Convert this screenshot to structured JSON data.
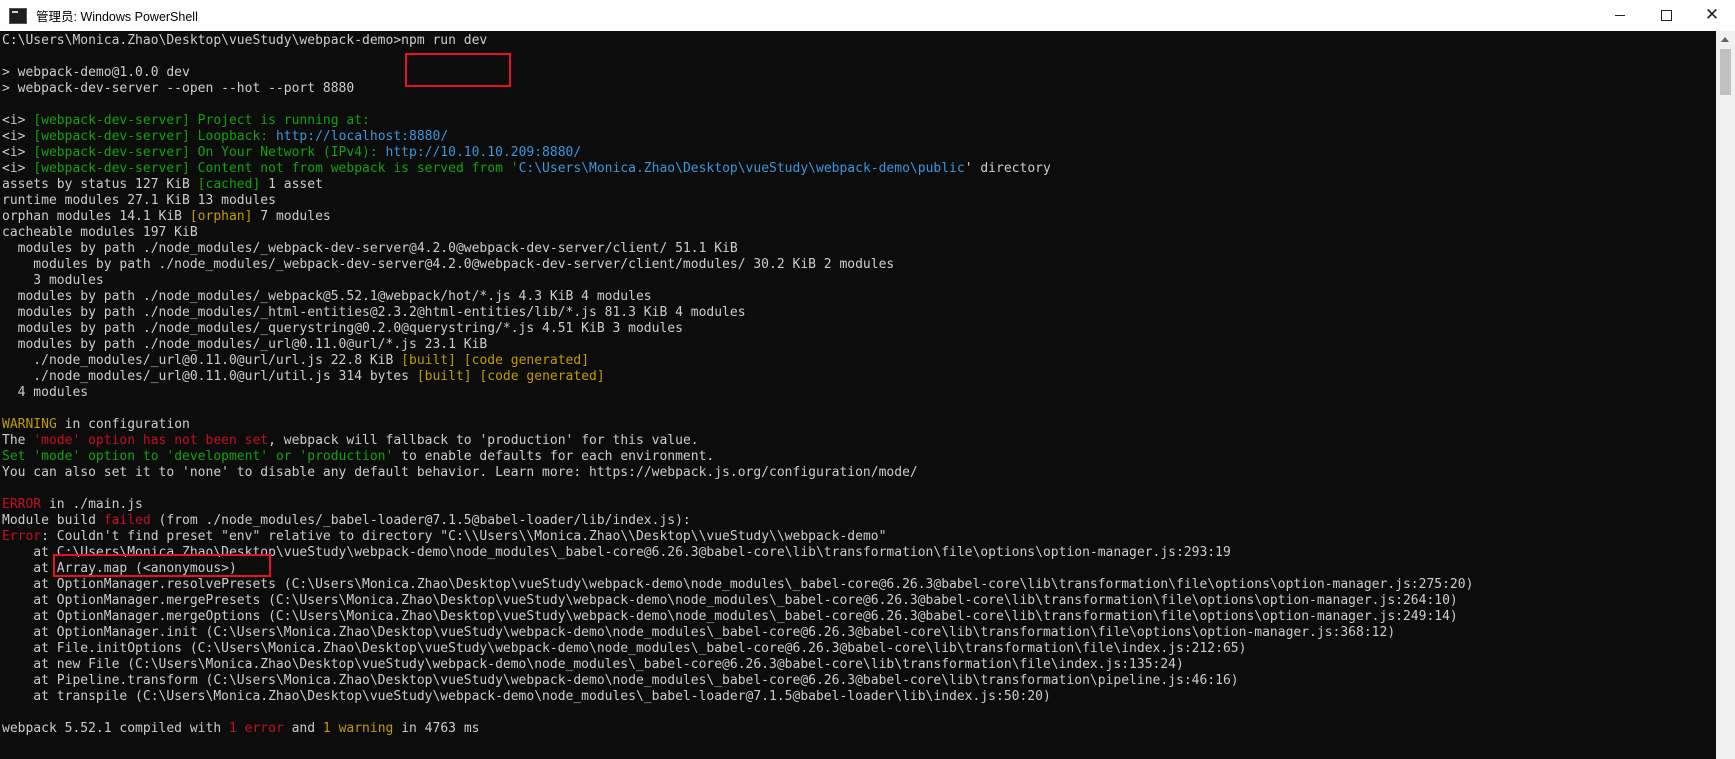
{
  "window": {
    "title": "管理员: Windows PowerShell",
    "icon": "powershell-console-icon",
    "buttons": [
      "minimize-icon",
      "maximize-icon",
      "close-icon"
    ]
  },
  "highlight_color": "#e81123",
  "console": {
    "lines": [
      [
        {
          "t": "C:\\Users\\Monica.Zhao\\Desktop\\vueStudy\\webpack-demo>npm run dev",
          "c": "c-default"
        }
      ],
      [
        {
          "t": "",
          "c": "c-default"
        }
      ],
      [
        {
          "t": "> webpack-demo@1.0.0 dev",
          "c": "c-default"
        }
      ],
      [
        {
          "t": "> webpack-dev-server --open --hot --port 8880",
          "c": "c-default"
        }
      ],
      [
        {
          "t": "",
          "c": "c-default"
        }
      ],
      [
        {
          "t": "<i> ",
          "c": "c-default"
        },
        {
          "t": "[webpack-dev-server] Project is running at:",
          "c": "c-green"
        }
      ],
      [
        {
          "t": "<i> ",
          "c": "c-default"
        },
        {
          "t": "[webpack-dev-server] Loopback: ",
          "c": "c-green"
        },
        {
          "t": "http://localhost:8880/",
          "c": "c-cyan"
        }
      ],
      [
        {
          "t": "<i> ",
          "c": "c-default"
        },
        {
          "t": "[webpack-dev-server] On Your Network (IPv4): ",
          "c": "c-green"
        },
        {
          "t": "http://10.10.10.209:8880/",
          "c": "c-cyan"
        }
      ],
      [
        {
          "t": "<i> ",
          "c": "c-default"
        },
        {
          "t": "[webpack-dev-server] Content not from webpack is served from '",
          "c": "c-green"
        },
        {
          "t": "C:\\Users\\Monica.Zhao\\Desktop\\vueStudy\\webpack-demo\\public",
          "c": "c-cyan"
        },
        {
          "t": "' directory",
          "c": "c-default"
        }
      ],
      [
        {
          "t": "assets by status 127 KiB ",
          "c": "c-default"
        },
        {
          "t": "[cached]",
          "c": "c-green"
        },
        {
          "t": " 1 asset",
          "c": "c-default"
        }
      ],
      [
        {
          "t": "runtime modules 27.1 KiB 13 modules",
          "c": "c-default"
        }
      ],
      [
        {
          "t": "orphan modules 14.1 KiB ",
          "c": "c-default"
        },
        {
          "t": "[orphan]",
          "c": "c-yellow"
        },
        {
          "t": " 7 modules",
          "c": "c-default"
        }
      ],
      [
        {
          "t": "cacheable modules 197 KiB",
          "c": "c-default"
        }
      ],
      [
        {
          "t": "  modules by path ./node_modules/_webpack-dev-server@4.2.0@webpack-dev-server/client/ 51.1 KiB",
          "c": "c-default"
        }
      ],
      [
        {
          "t": "    modules by path ./node_modules/_webpack-dev-server@4.2.0@webpack-dev-server/client/modules/ 30.2 KiB 2 modules",
          "c": "c-default"
        }
      ],
      [
        {
          "t": "    3 modules",
          "c": "c-default"
        }
      ],
      [
        {
          "t": "  modules by path ./node_modules/_webpack@5.52.1@webpack/hot/*.js 4.3 KiB 4 modules",
          "c": "c-default"
        }
      ],
      [
        {
          "t": "  modules by path ./node_modules/_html-entities@2.3.2@html-entities/lib/*.js 81.3 KiB 4 modules",
          "c": "c-default"
        }
      ],
      [
        {
          "t": "  modules by path ./node_modules/_querystring@0.2.0@querystring/*.js 4.51 KiB 3 modules",
          "c": "c-default"
        }
      ],
      [
        {
          "t": "  modules by path ./node_modules/_url@0.11.0@url/*.js 23.1 KiB",
          "c": "c-default"
        }
      ],
      [
        {
          "t": "    ./node_modules/_url@0.11.0@url/url.js 22.8 KiB ",
          "c": "c-default"
        },
        {
          "t": "[built]",
          "c": "c-yellow"
        },
        {
          "t": " ",
          "c": "c-default"
        },
        {
          "t": "[code generated]",
          "c": "c-yellow"
        }
      ],
      [
        {
          "t": "    ./node_modules/_url@0.11.0@url/util.js 314 bytes ",
          "c": "c-default"
        },
        {
          "t": "[built]",
          "c": "c-yellow"
        },
        {
          "t": " ",
          "c": "c-default"
        },
        {
          "t": "[code generated]",
          "c": "c-yellow"
        }
      ],
      [
        {
          "t": "  4 modules",
          "c": "c-default"
        }
      ],
      [
        {
          "t": "",
          "c": "c-default"
        }
      ],
      [
        {
          "t": "WARNING",
          "c": "c-yellow"
        },
        {
          "t": " in configuration",
          "c": "c-default"
        }
      ],
      [
        {
          "t": "The ",
          "c": "c-default"
        },
        {
          "t": "'mode' option has not been set",
          "c": "c-red"
        },
        {
          "t": ", webpack will fallback to 'production' for this value.",
          "c": "c-default"
        }
      ],
      [
        {
          "t": "Set ",
          "c": "c-green"
        },
        {
          "t": "'mode' option to 'development' or 'production'",
          "c": "c-green"
        },
        {
          "t": " to enable defaults for each environment.",
          "c": "c-default"
        }
      ],
      [
        {
          "t": "You can also set it to 'none' to disable any default behavior. Learn more: https://webpack.js.org/configuration/mode/",
          "c": "c-default"
        }
      ],
      [
        {
          "t": "",
          "c": "c-default"
        }
      ],
      [
        {
          "t": "ERROR",
          "c": "c-red"
        },
        {
          "t": " in ./main.js",
          "c": "c-default"
        }
      ],
      [
        {
          "t": "Module build ",
          "c": "c-default"
        },
        {
          "t": "failed",
          "c": "c-red"
        },
        {
          "t": " (from ./node_modules/_babel-loader@7.1.5@babel-loader/lib/index.js):",
          "c": "c-default"
        }
      ],
      [
        {
          "t": "Error",
          "c": "c-red"
        },
        {
          "t": ": Couldn't find preset \"env\" relative to directory \"C:\\\\Users\\\\Monica.Zhao\\\\Desktop\\\\vueStudy\\\\webpack-demo\"",
          "c": "c-default"
        }
      ],
      [
        {
          "t": "    at C:\\Users\\Monica.Zhao\\Desktop\\vueStudy\\webpack-demo\\node_modules\\_babel-core@6.26.3@babel-core\\lib\\transformation\\file\\options\\option-manager.js:293:19",
          "c": "c-default"
        }
      ],
      [
        {
          "t": "    at Array.map (<anonymous>)",
          "c": "c-default"
        }
      ],
      [
        {
          "t": "    at OptionManager.resolvePresets (C:\\Users\\Monica.Zhao\\Desktop\\vueStudy\\webpack-demo\\node_modules\\_babel-core@6.26.3@babel-core\\lib\\transformation\\file\\options\\option-manager.js:275:20)",
          "c": "c-default"
        }
      ],
      [
        {
          "t": "    at OptionManager.mergePresets (C:\\Users\\Monica.Zhao\\Desktop\\vueStudy\\webpack-demo\\node_modules\\_babel-core@6.26.3@babel-core\\lib\\transformation\\file\\options\\option-manager.js:264:10)",
          "c": "c-default"
        }
      ],
      [
        {
          "t": "    at OptionManager.mergeOptions (C:\\Users\\Monica.Zhao\\Desktop\\vueStudy\\webpack-demo\\node_modules\\_babel-core@6.26.3@babel-core\\lib\\transformation\\file\\options\\option-manager.js:249:14)",
          "c": "c-default"
        }
      ],
      [
        {
          "t": "    at OptionManager.init (C:\\Users\\Monica.Zhao\\Desktop\\vueStudy\\webpack-demo\\node_modules\\_babel-core@6.26.3@babel-core\\lib\\transformation\\file\\options\\option-manager.js:368:12)",
          "c": "c-default"
        }
      ],
      [
        {
          "t": "    at File.initOptions (C:\\Users\\Monica.Zhao\\Desktop\\vueStudy\\webpack-demo\\node_modules\\_babel-core@6.26.3@babel-core\\lib\\transformation\\file\\index.js:212:65)",
          "c": "c-default"
        }
      ],
      [
        {
          "t": "    at new File (C:\\Users\\Monica.Zhao\\Desktop\\vueStudy\\webpack-demo\\node_modules\\_babel-core@6.26.3@babel-core\\lib\\transformation\\file\\index.js:135:24)",
          "c": "c-default"
        }
      ],
      [
        {
          "t": "    at Pipeline.transform (C:\\Users\\Monica.Zhao\\Desktop\\vueStudy\\webpack-demo\\node_modules\\_babel-core@6.26.3@babel-core\\lib\\transformation\\pipeline.js:46:16)",
          "c": "c-default"
        }
      ],
      [
        {
          "t": "    at transpile (C:\\Users\\Monica.Zhao\\Desktop\\vueStudy\\webpack-demo\\node_modules\\_babel-loader@7.1.5@babel-loader\\lib\\index.js:50:20)",
          "c": "c-default"
        }
      ],
      [
        {
          "t": "",
          "c": "c-default"
        }
      ],
      [
        {
          "t": "webpack 5.52.1 compiled with ",
          "c": "c-default"
        },
        {
          "t": "1 error",
          "c": "c-red"
        },
        {
          "t": " and ",
          "c": "c-default"
        },
        {
          "t": "1 warning",
          "c": "c-yellow"
        },
        {
          "t": " in 4763 ms",
          "c": "c-default"
        }
      ]
    ]
  }
}
